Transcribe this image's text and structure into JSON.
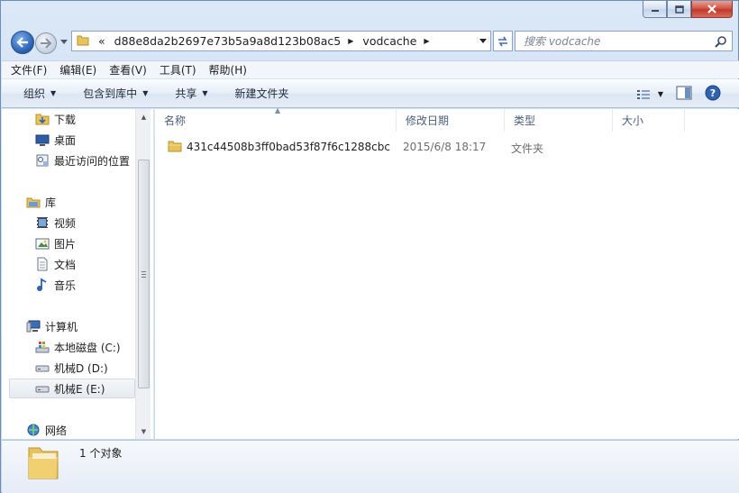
{
  "window": {
    "caption_buttons": [
      "minimize",
      "maximize",
      "close"
    ]
  },
  "address": {
    "overflow": "«",
    "crumbs": [
      "d88e8da2b2697e73b5a9a8d123b08ac5",
      "vodcache"
    ],
    "search_placeholder": "搜索 vodcache"
  },
  "menu": [
    "文件(F)",
    "编辑(E)",
    "查看(V)",
    "工具(T)",
    "帮助(H)"
  ],
  "toolbar": {
    "organize": "组织",
    "include_library": "包含到库中",
    "share": "共享",
    "new_folder": "新建文件夹"
  },
  "nav": {
    "items": [
      {
        "label": "下载",
        "icon": "download-folder-icon"
      },
      {
        "label": "桌面",
        "icon": "desktop-icon"
      },
      {
        "label": "最近访问的位置",
        "icon": "recent-places-icon"
      },
      {
        "label": "库",
        "icon": "library-icon"
      },
      {
        "label": "视频",
        "icon": "video-icon"
      },
      {
        "label": "图片",
        "icon": "pictures-icon"
      },
      {
        "label": "文档",
        "icon": "documents-icon"
      },
      {
        "label": "音乐",
        "icon": "music-icon"
      },
      {
        "label": "计算机",
        "icon": "computer-icon"
      },
      {
        "label": "本地磁盘 (C:)",
        "icon": "system-drive-icon"
      },
      {
        "label": "机械D (D:)",
        "icon": "drive-icon"
      },
      {
        "label": "机械E (E:)",
        "icon": "drive-icon"
      },
      {
        "label": "网络",
        "icon": "network-icon"
      }
    ],
    "selected": "机械E (E:)"
  },
  "columns": {
    "name": "名称",
    "modified": "修改日期",
    "type": "类型",
    "size": "大小"
  },
  "files": [
    {
      "name": "431c44508b3ff0bad53f87f6c1288cbc",
      "modified": "2015/6/8 18:17",
      "type": "文件夹",
      "size": ""
    }
  ],
  "status": {
    "count": "1 个对象"
  },
  "colors": {
    "accent": "#3a6fb8",
    "folder": "#e8c25a"
  }
}
